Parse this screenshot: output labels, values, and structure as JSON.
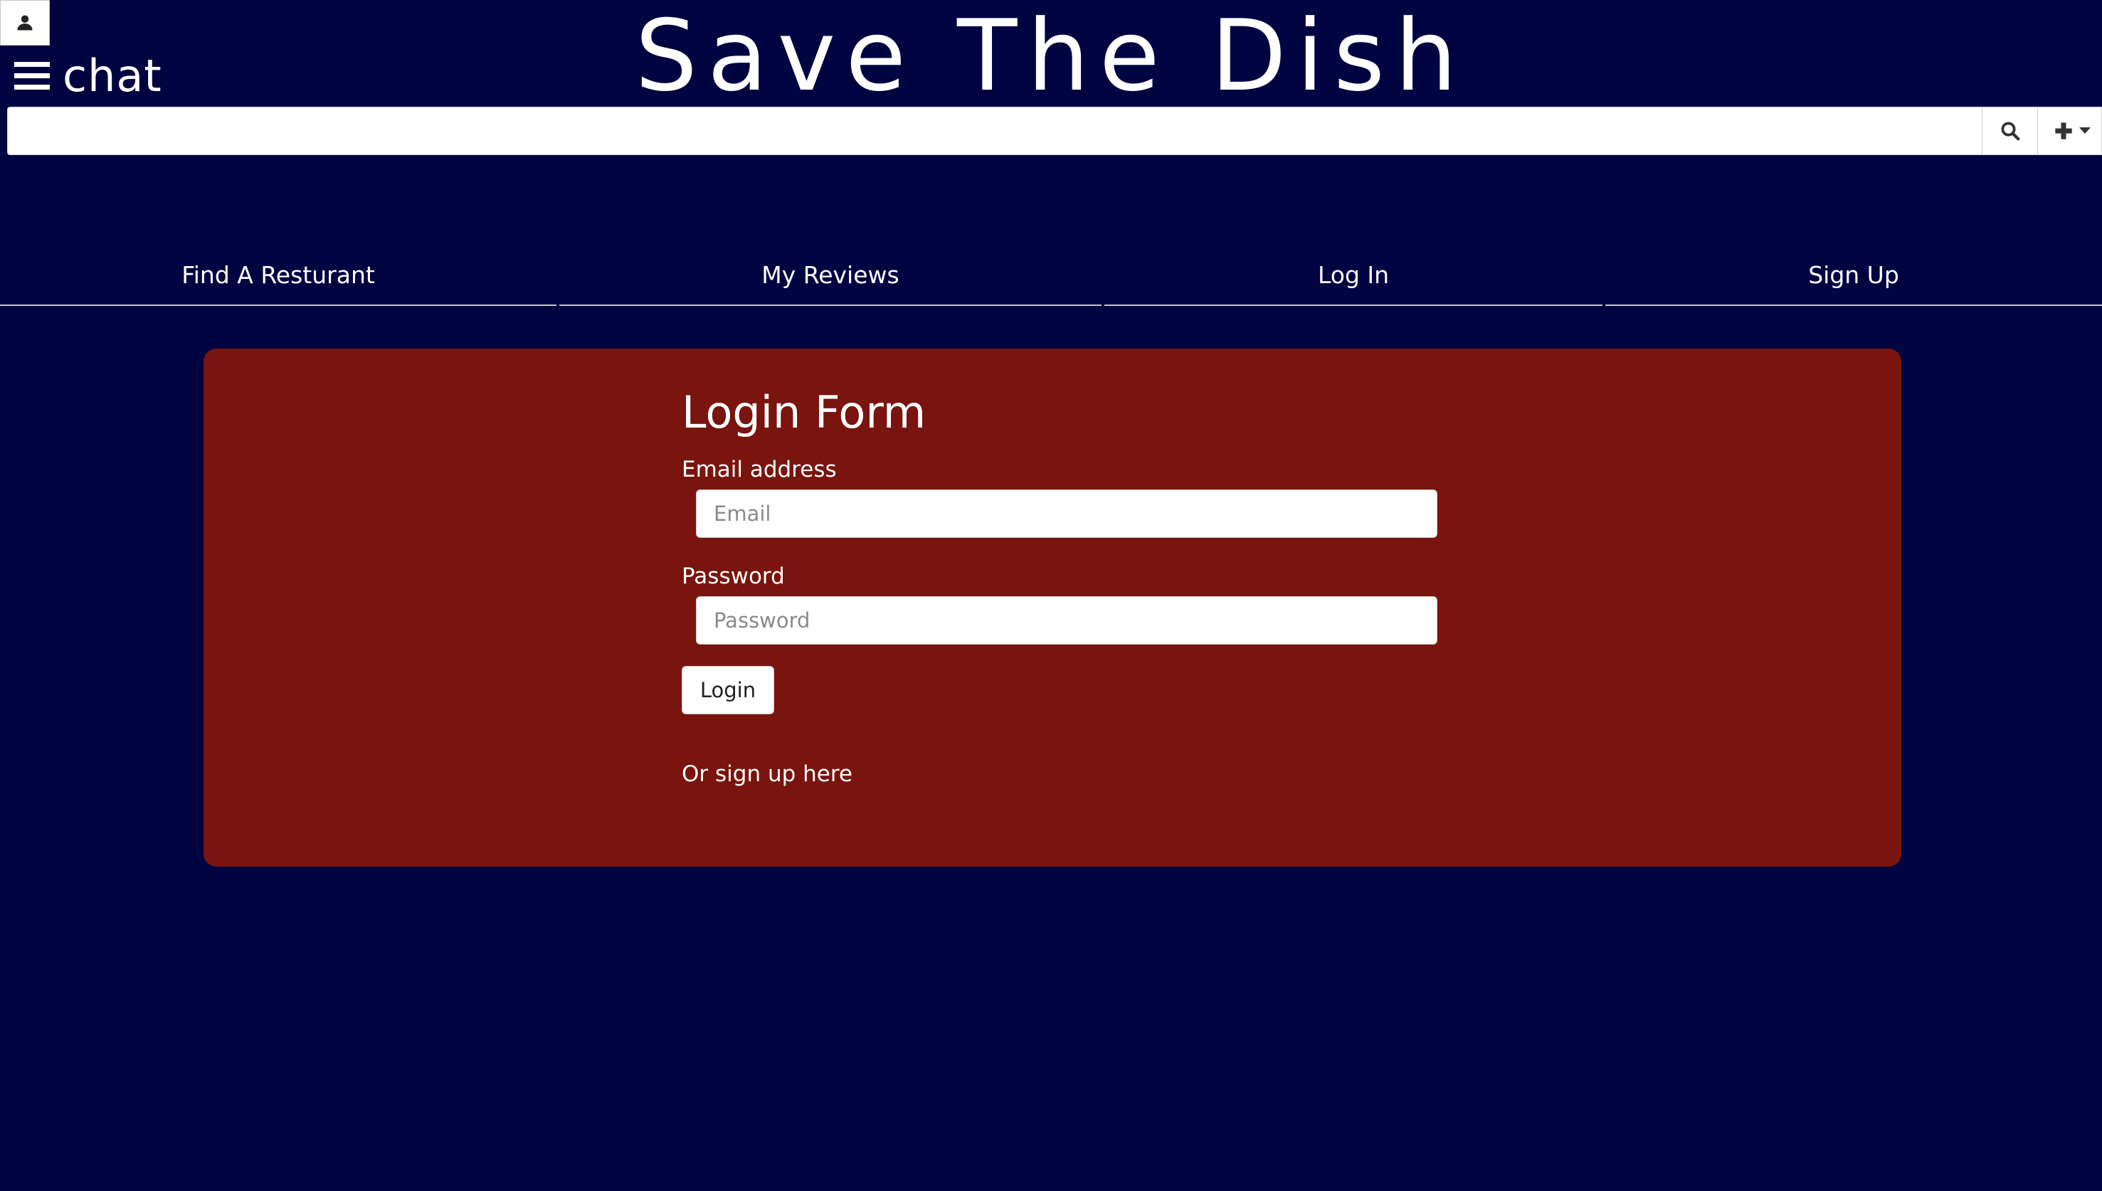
{
  "header": {
    "site_title": "Save The Dish",
    "chat_label": "chat",
    "user_icon": "user-icon",
    "menu_icon": "hamburger-icon"
  },
  "search": {
    "value": "",
    "placeholder": "",
    "search_icon": "search-icon",
    "add_icon": "plus-icon"
  },
  "nav": {
    "items": [
      {
        "label": "Find A Resturant"
      },
      {
        "label": "My Reviews"
      },
      {
        "label": "Log In"
      },
      {
        "label": "Sign Up"
      }
    ]
  },
  "login_form": {
    "title": "Login Form",
    "email_label": "Email address",
    "email_placeholder": "Email",
    "email_value": "",
    "password_label": "Password",
    "password_placeholder": "Password",
    "password_value": "",
    "submit_label": "Login",
    "signup_text": "Or sign up here"
  },
  "colors": {
    "background": "#000441",
    "panel": "#79140e",
    "text": "#ffffff"
  }
}
